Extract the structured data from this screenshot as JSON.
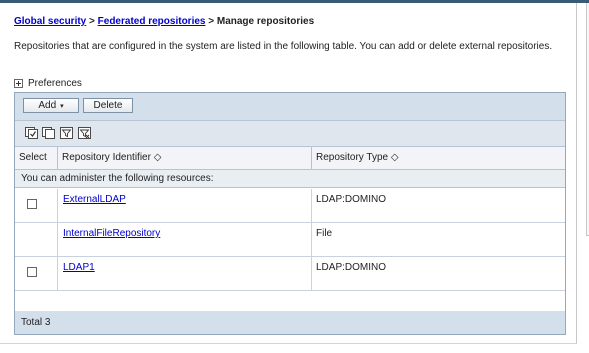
{
  "breadcrumb": {
    "global_security": "Global security",
    "sep1": ">",
    "federated_repositories": "Federated repositories",
    "sep2": ">",
    "current": "Manage repositories"
  },
  "description": "Repositories that are configured in the system are listed in the following table. You can add or delete external repositories.",
  "preferences": {
    "label": "Preferences",
    "icon": "expand-plus-icon"
  },
  "toolbar": {
    "add_label": "Add",
    "add_caret": "▾",
    "delete_label": "Delete"
  },
  "icon_toolbar": [
    "select-all-icon",
    "deselect-all-icon",
    "show-filter-icon",
    "clear-filter-icon"
  ],
  "table": {
    "columns": {
      "select": "Select",
      "identifier": "Repository Identifier",
      "type": "Repository Type",
      "sort_glyph": "◇"
    },
    "instruction": "You can administer the following resources:",
    "rows": [
      {
        "identifier": "ExternalLDAP",
        "type": "LDAP:DOMINO",
        "selectable": true
      },
      {
        "identifier": "InternalFileRepository",
        "type": "File",
        "selectable": false
      },
      {
        "identifier": "LDAP1",
        "type": "LDAP:DOMINO",
        "selectable": true
      }
    ],
    "total": "Total 3"
  },
  "colors": {
    "link": "#0000cc",
    "toolbar_bg": "#d4dfec",
    "panel_border": "#94a8bd"
  }
}
